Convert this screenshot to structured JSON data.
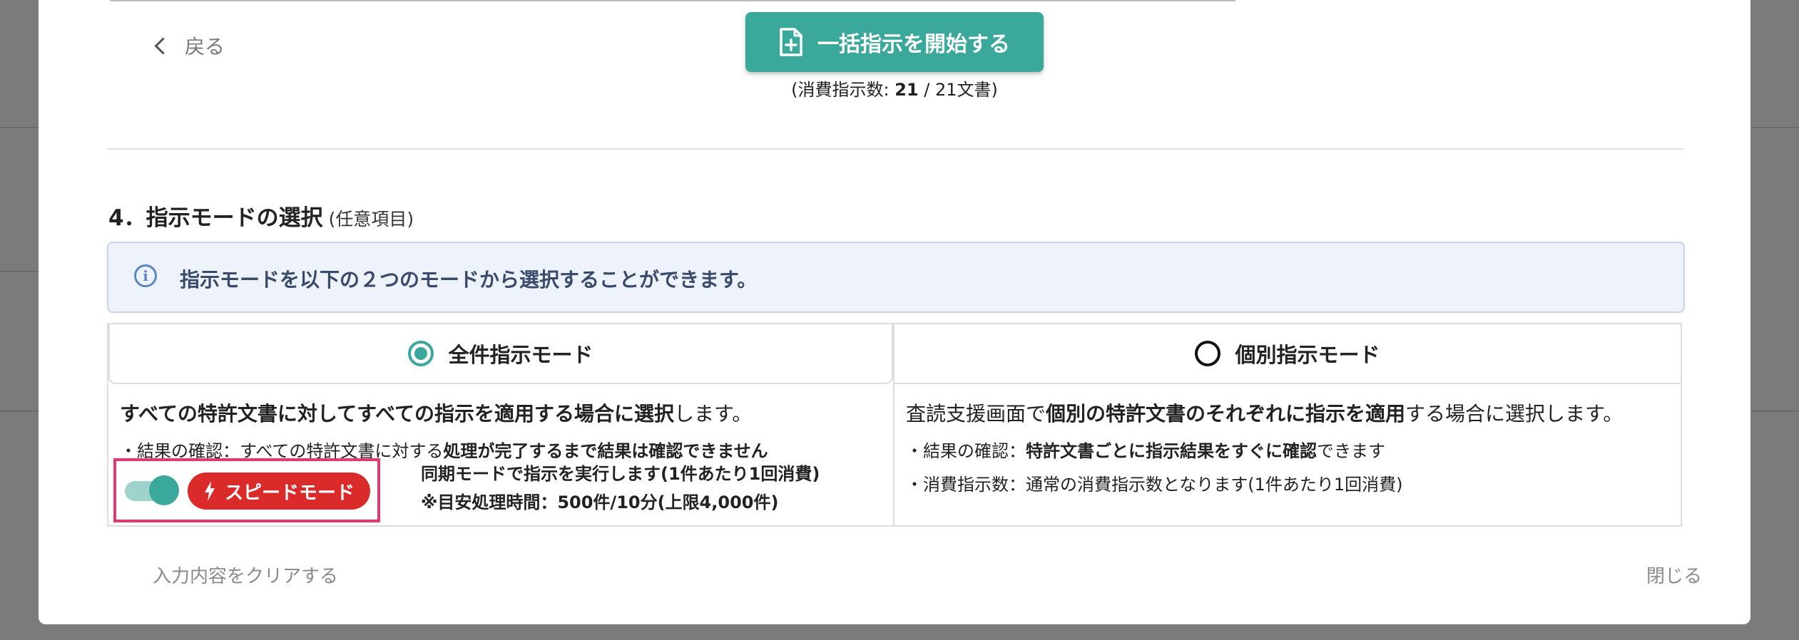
{
  "header": {
    "back_label": "戻る",
    "start_button_label": "一括指示を開始する",
    "count_prefix": "(消費指示数: ",
    "count_used": "21",
    "count_suffix": " / 21文書)"
  },
  "section": {
    "title": "4．指示モードの選択",
    "optional": "(任意項目)"
  },
  "info": {
    "text": "指示モードを以下の２つのモードから選択することができます。"
  },
  "modes": {
    "all": {
      "tab_label": "全件指示モード",
      "selected": true,
      "main_bold": "すべての特許文書に対してすべての指示を適用する場合に選択",
      "main_rest": "します。",
      "result_prefix": "・結果の確認：すべての特許文書に対する",
      "result_bold": "処理が完了するまで結果は確認できません",
      "line2": "同期モードで指示を実行します(1件あたり1回消費)",
      "line3": "※目安処理時間：500件/10分(上限4,000件)"
    },
    "individual": {
      "tab_label": "個別指示モード",
      "selected": false,
      "main_pre": "査読支援画面で",
      "main_bold": "個別の特許文書のそれぞれに指示を適用",
      "main_rest": "する場合に選択します。",
      "result_prefix": "・結果の確認：",
      "result_bold": "特許文書ごとに指示結果をすぐに確認",
      "result_rest": "できます",
      "consume": "・消費指示数：通常の消費指示数となります(1件あたり1回消費)"
    }
  },
  "speed_mode": {
    "label": "スピードモード",
    "enabled": true,
    "color": "#db2a2a"
  },
  "footer": {
    "clear_label": "入力内容をクリアする",
    "close_label": "閉じる"
  },
  "colors": {
    "accent": "#3aa89a",
    "highlight_border": "#e8366f"
  }
}
